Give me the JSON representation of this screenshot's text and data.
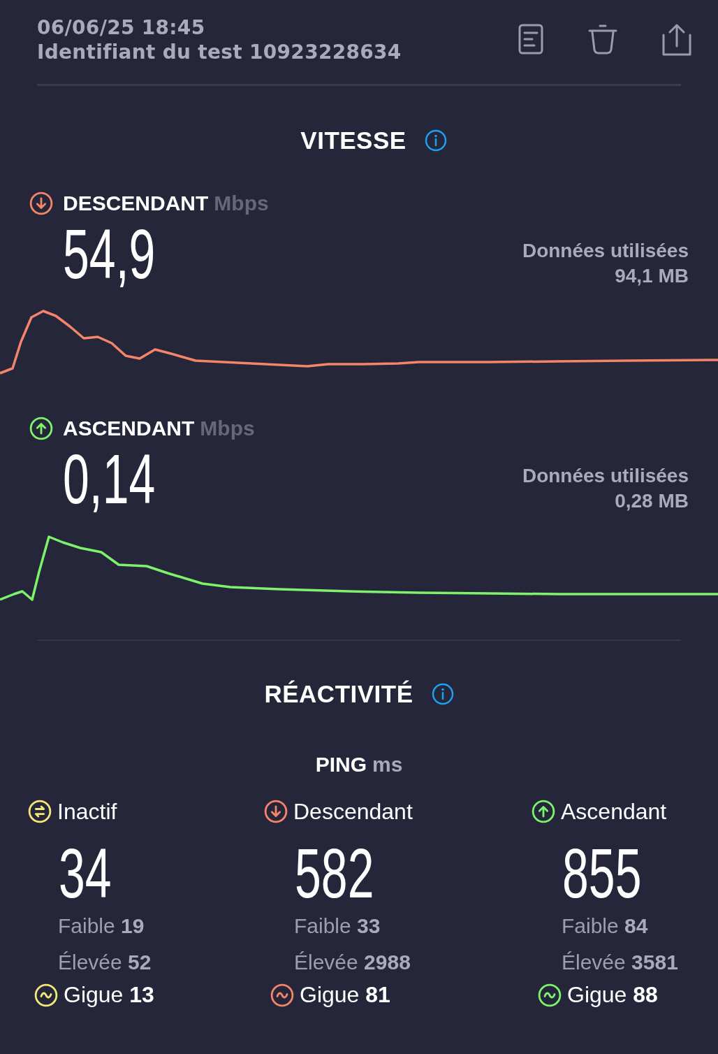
{
  "header": {
    "date": "06/06/25 18:45",
    "test_id": "Identifiant du test 10923228634"
  },
  "speed": {
    "title": "VITESSE",
    "results": [
      {
        "kind": "download",
        "label": "DESCENDANT",
        "unit": "Mbps",
        "value": "54,9",
        "data_label": "Données utilisées",
        "data_value": "94,1 MB",
        "color": "#f4846a"
      },
      {
        "kind": "upload",
        "label": "ASCENDANT",
        "unit": "Mbps",
        "value": "0,14",
        "data_label": "Données utilisées",
        "data_value": "0,28 MB",
        "color": "#7df26b"
      }
    ]
  },
  "responsiveness": {
    "title": "RÉACTIVITÉ",
    "ping_label": "PING",
    "ping_unit": "ms",
    "columns": [
      {
        "kind": "idle",
        "label": "Inactif",
        "value": "34",
        "low": "Faible **19**",
        "high": "Élevée **52**",
        "jitter": "Gigue **13**",
        "color": "#f2e77a"
      },
      {
        "kind": "download",
        "label": "Descendant",
        "value": "582",
        "low": "Faible **33**",
        "high": "Élevée **2988**",
        "jitter": "Gigue **81**",
        "color": "#f4846a"
      },
      {
        "kind": "upload",
        "label": "Ascendant",
        "value": "855",
        "low": "Faible **84**",
        "high": "Élevée **3581**",
        "jitter": "Gigue **88**",
        "color": "#7df26b"
      }
    ]
  }
}
